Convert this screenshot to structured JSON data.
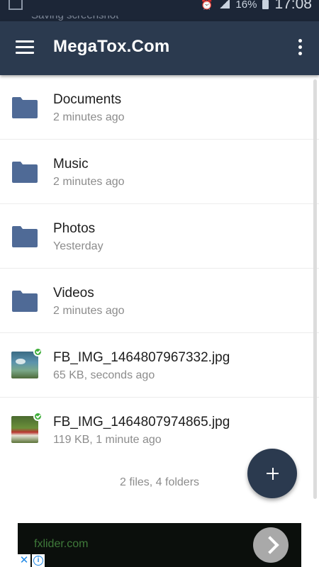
{
  "status_bar": {
    "notification_text": "Saving screenshot",
    "battery": "16%",
    "time": "17:08",
    "icons": [
      "notification-icon",
      "alarm-icon",
      "signal-icon",
      "battery-icon"
    ]
  },
  "app_bar": {
    "title": "MegaTox.Com",
    "menu_icon": "hamburger-menu-icon",
    "overflow_icon": "more-vert-icon"
  },
  "items": [
    {
      "type": "folder",
      "name": "Documents",
      "meta": "2 minutes ago",
      "icon": "folder-icon"
    },
    {
      "type": "folder",
      "name": "Music",
      "meta": "2 minutes ago",
      "icon": "folder-icon"
    },
    {
      "type": "folder",
      "name": "Photos",
      "meta": "Yesterday",
      "icon": "folder-icon"
    },
    {
      "type": "folder",
      "name": "Videos",
      "meta": "2 minutes ago",
      "icon": "folder-icon"
    },
    {
      "type": "file",
      "name": "FB_IMG_1464807967332.jpg",
      "meta": "65 KB, seconds ago",
      "icon": "image-thumbnail"
    },
    {
      "type": "file",
      "name": "FB_IMG_1464807974865.jpg",
      "meta": "119 KB, 1 minute ago",
      "icon": "image-thumbnail"
    }
  ],
  "summary": "2 files, 4 folders",
  "fab": {
    "icon": "plus-icon"
  },
  "ad": {
    "text": "fxlider.com",
    "arrow_icon": "chevron-right-icon",
    "close_icon": "close-icon",
    "info_icon": "info-icon"
  },
  "colors": {
    "primary": "#2b3a4f",
    "status_bar": "#1c2637",
    "folder": "#4f6a96",
    "sync_check": "#3fae3a"
  }
}
